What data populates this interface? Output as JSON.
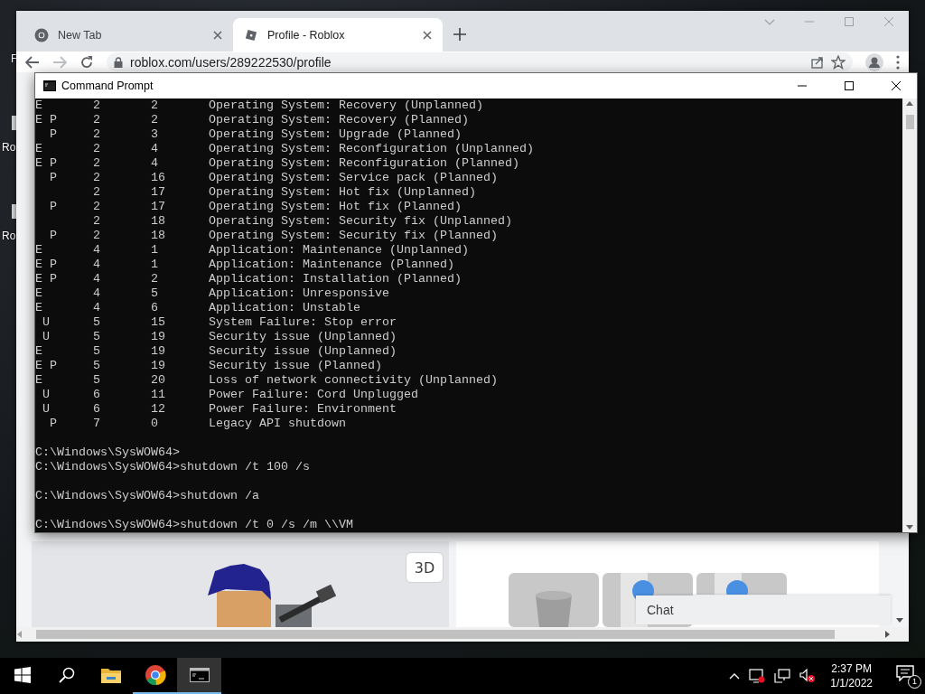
{
  "desktop": {
    "icon_labels": [
      "F",
      "Ro",
      "Ro"
    ]
  },
  "browser": {
    "tabs": [
      {
        "label": "New Tab",
        "selected": false,
        "kind": "chrome"
      },
      {
        "label": "Profile - Roblox",
        "selected": true,
        "kind": "roblox"
      }
    ],
    "address": "roblox.com/users/289222530/profile",
    "page": {
      "view_button": "3D",
      "chat_label": "Chat"
    }
  },
  "command_prompt": {
    "title": "Command Prompt",
    "rows": [
      {
        "e": "E",
        "major": "2",
        "minor": "2",
        "reason": "Operating System: Recovery (Unplanned)"
      },
      {
        "e": "E",
        "p": "P",
        "major": "2",
        "minor": "2",
        "reason": "Operating System: Recovery (Planned)"
      },
      {
        "p": "P",
        "major": "2",
        "minor": "3",
        "reason": "Operating System: Upgrade (Planned)"
      },
      {
        "e": "E",
        "major": "2",
        "minor": "4",
        "reason": "Operating System: Reconfiguration (Unplanned)"
      },
      {
        "e": "E",
        "p": "P",
        "major": "2",
        "minor": "4",
        "reason": "Operating System: Reconfiguration (Planned)"
      },
      {
        "p": "P",
        "major": "2",
        "minor": "16",
        "reason": "Operating System: Service pack (Planned)"
      },
      {
        "major": "2",
        "minor": "17",
        "reason": "Operating System: Hot fix (Unplanned)"
      },
      {
        "p": "P",
        "major": "2",
        "minor": "17",
        "reason": "Operating System: Hot fix (Planned)"
      },
      {
        "major": "2",
        "minor": "18",
        "reason": "Operating System: Security fix (Unplanned)"
      },
      {
        "p": "P",
        "major": "2",
        "minor": "18",
        "reason": "Operating System: Security fix (Planned)"
      },
      {
        "e": "E",
        "major": "4",
        "minor": "1",
        "reason": "Application: Maintenance (Unplanned)"
      },
      {
        "e": "E",
        "p": "P",
        "major": "4",
        "minor": "1",
        "reason": "Application: Maintenance (Planned)"
      },
      {
        "e": "E",
        "p": "P",
        "major": "4",
        "minor": "2",
        "reason": "Application: Installation (Planned)"
      },
      {
        "e": "E",
        "major": "4",
        "minor": "5",
        "reason": "Application: Unresponsive"
      },
      {
        "e": "E",
        "major": "4",
        "minor": "6",
        "reason": "Application: Unstable"
      },
      {
        "u": "U",
        "major": "5",
        "minor": "15",
        "reason": "System Failure: Stop error"
      },
      {
        "u": "U",
        "major": "5",
        "minor": "19",
        "reason": "Security issue (Unplanned)"
      },
      {
        "e": "E",
        "major": "5",
        "minor": "19",
        "reason": "Security issue (Unplanned)"
      },
      {
        "e": "E",
        "p": "P",
        "major": "5",
        "minor": "19",
        "reason": "Security issue (Planned)"
      },
      {
        "e": "E",
        "major": "5",
        "minor": "20",
        "reason": "Loss of network connectivity (Unplanned)"
      },
      {
        "u": "U",
        "major": "6",
        "minor": "11",
        "reason": "Power Failure: Cord Unplugged"
      },
      {
        "u": "U",
        "major": "6",
        "minor": "12",
        "reason": "Power Failure: Environment"
      },
      {
        "p": "P",
        "major": "7",
        "minor": "0",
        "reason": "Legacy API shutdown"
      }
    ],
    "lines": [
      {
        "kind": "blank"
      },
      {
        "kind": "output",
        "text": "C:\\Windows\\SysWOW64>"
      },
      {
        "kind": "output",
        "text": "C:\\Windows\\SysWOW64>shutdown /t 100 /s"
      },
      {
        "kind": "blank"
      },
      {
        "kind": "output",
        "text": "C:\\Windows\\SysWOW64>shutdown /a"
      },
      {
        "kind": "blank"
      },
      {
        "kind": "output",
        "text": "C:\\Windows\\SysWOW64>shutdown /t 0 /s /m \\\\VM"
      }
    ]
  },
  "taskbar": {
    "apps": [
      {
        "kind": "folder",
        "running": false,
        "selected": false
      },
      {
        "kind": "chrome",
        "running": true,
        "selected": false
      },
      {
        "kind": "terminal",
        "running": true,
        "selected": true
      }
    ],
    "time": "2:37 PM",
    "date": "1/1/2022",
    "notification_count": "1"
  }
}
